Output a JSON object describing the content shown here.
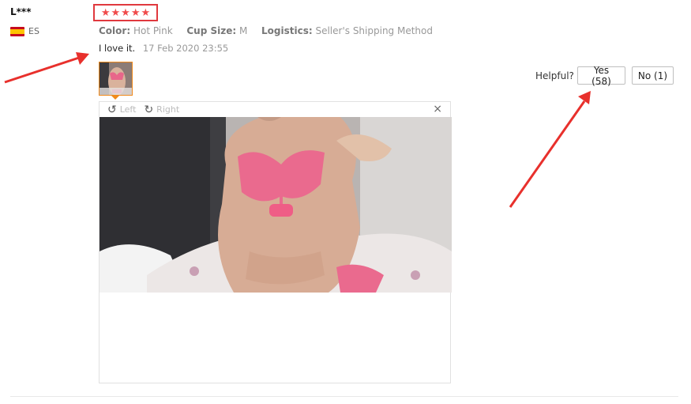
{
  "review": {
    "user_name": "L***",
    "country_code": "ES",
    "rating": 5,
    "attributes": [
      {
        "label": "Color:",
        "value": "Hot Pink"
      },
      {
        "label": "Cup Size:",
        "value": "M"
      },
      {
        "label": "Logistics:",
        "value": "Seller's Shipping Method"
      }
    ],
    "comment": "I love it.",
    "date": "17 Feb 2020 23:55"
  },
  "viewer": {
    "rotate_left_label": "Left",
    "rotate_right_label": "Right",
    "close_glyph": "×"
  },
  "helpful": {
    "label": "Helpful?",
    "yes_label": "Yes (58)",
    "no_label": "No (1)"
  },
  "colors": {
    "annotation": "#e8302c",
    "star": "#f04b4b",
    "thumb_border": "#f08a1c"
  },
  "icons": [
    "spain-flag-icon",
    "star-icon",
    "rotate-left-icon",
    "rotate-right-icon",
    "close-icon"
  ]
}
